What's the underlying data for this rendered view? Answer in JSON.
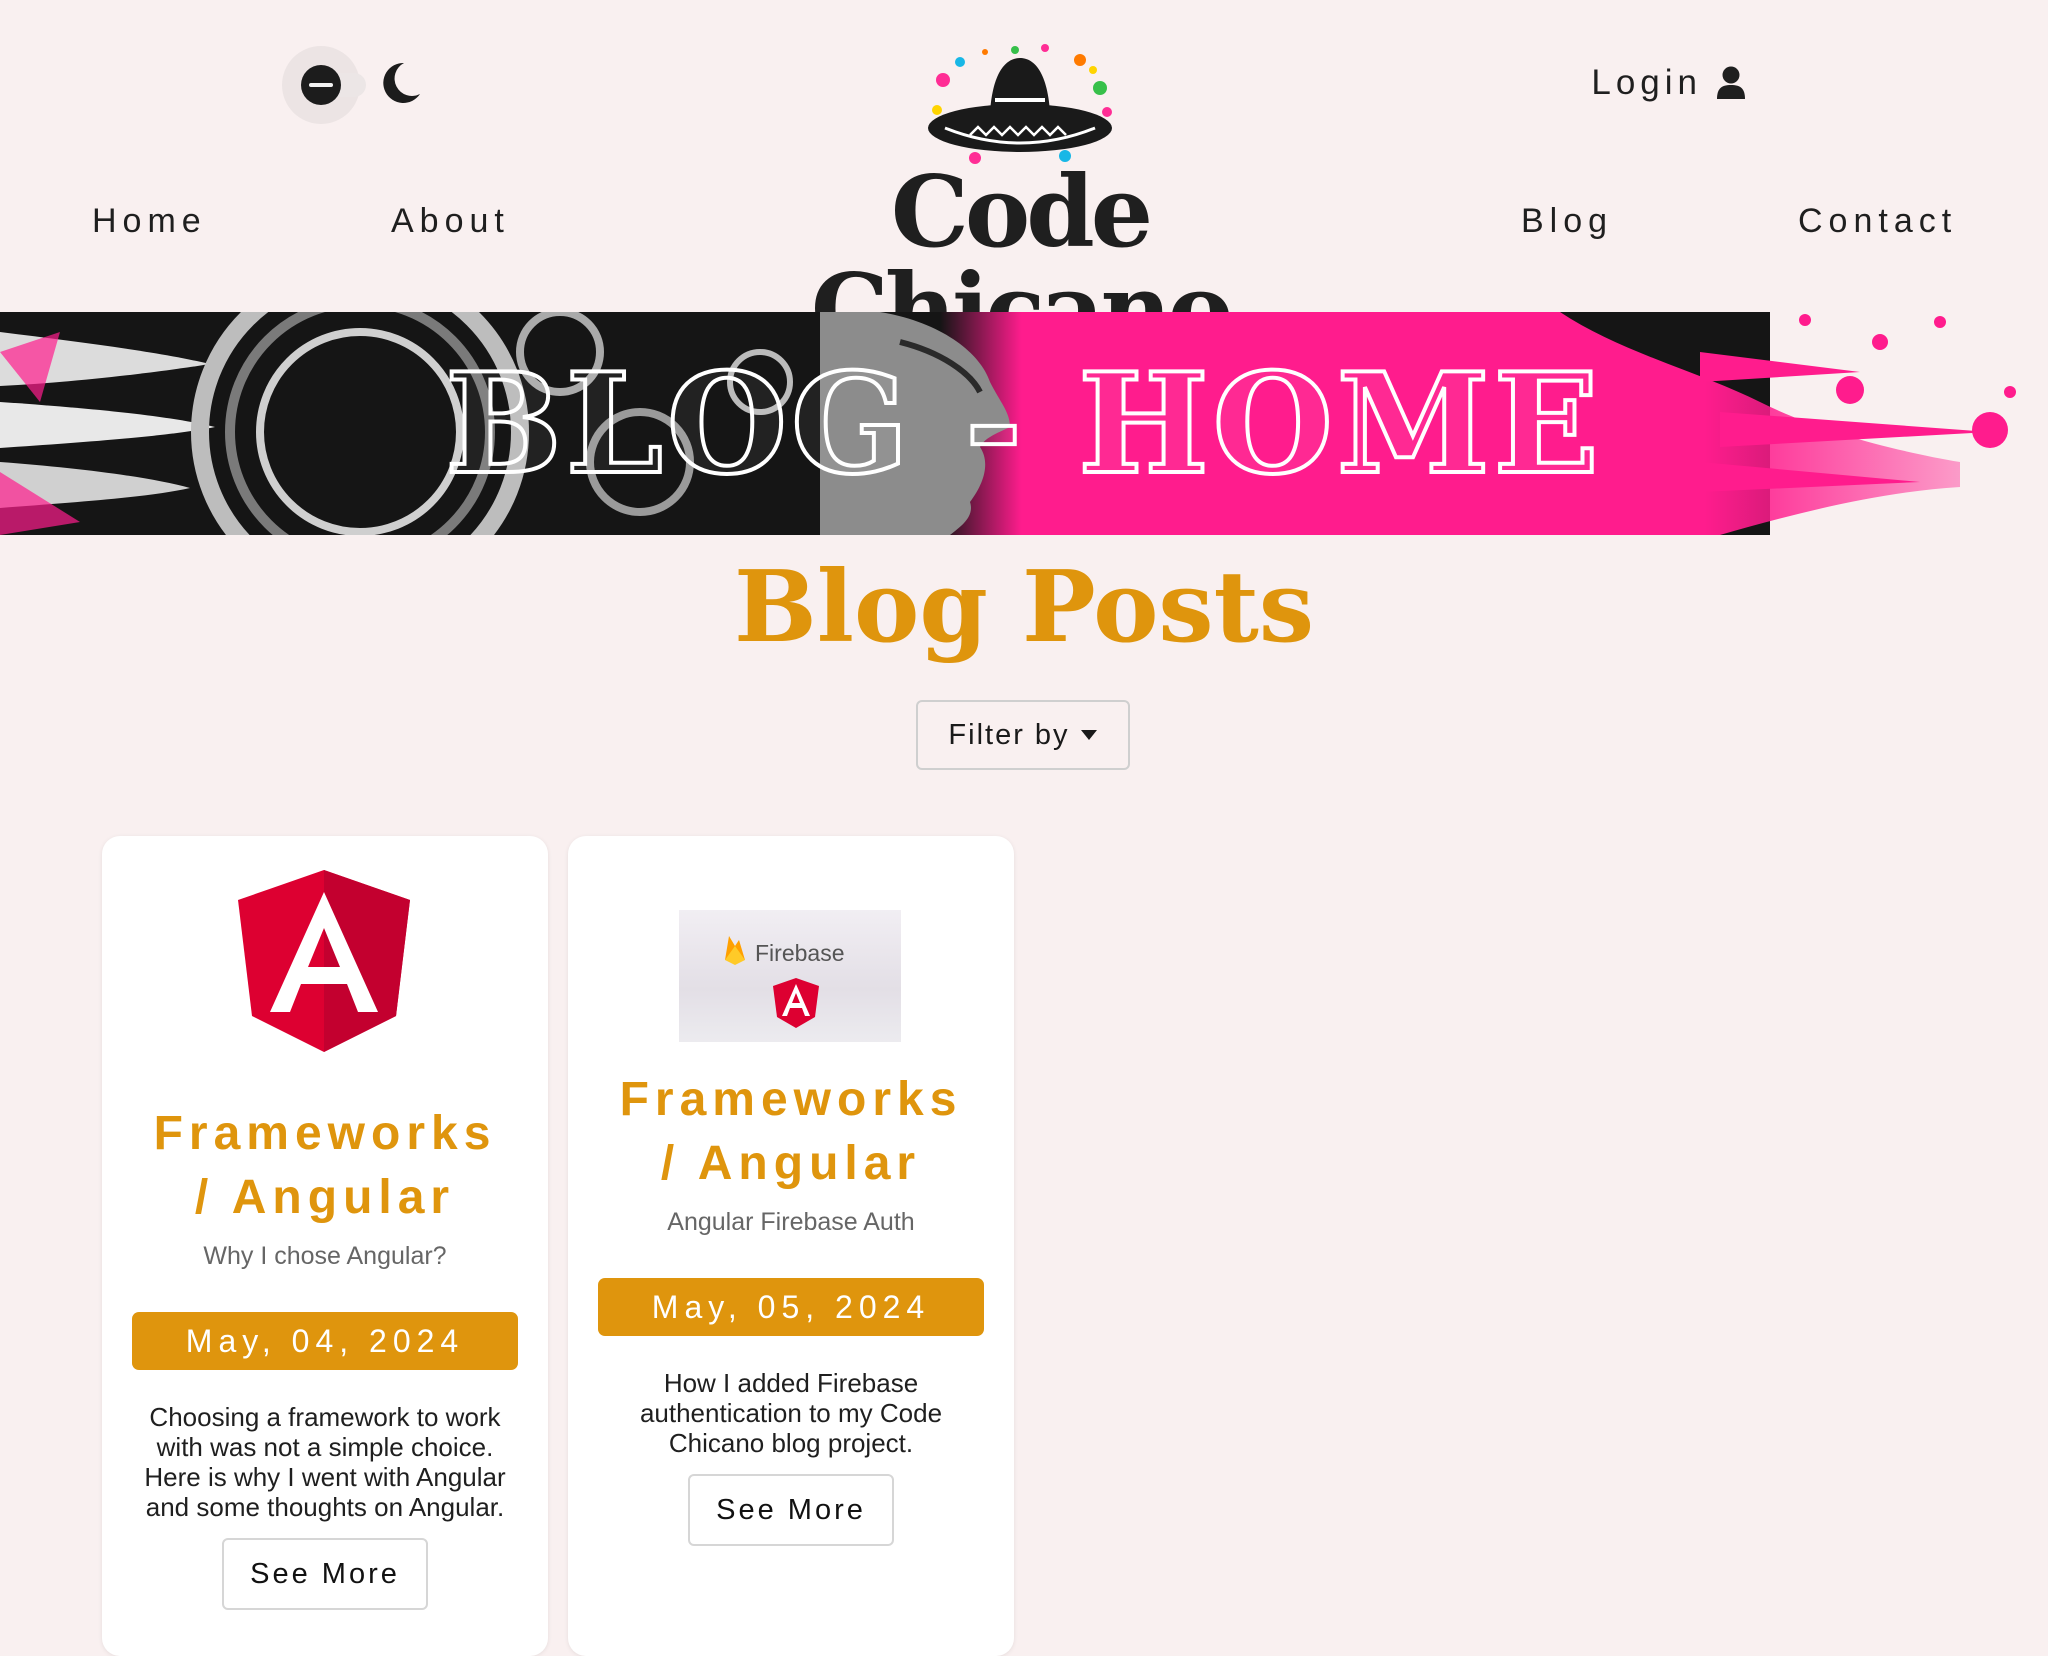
{
  "header": {
    "brand": "Code Chicano",
    "login_label": "Login",
    "nav": {
      "home": "Home",
      "about": "About",
      "blog": "Blog",
      "contact": "Contact"
    },
    "theme_toggle": {
      "state": "light",
      "icons": [
        "dark-mode-toggle",
        "moon-icon"
      ]
    }
  },
  "banner": {
    "title": "BLOG - HOME"
  },
  "main": {
    "title": "Blog Posts",
    "filter_label": "Filter by"
  },
  "posts": [
    {
      "image": "angular-logo",
      "category": [
        "Frameworks",
        "/ Angular"
      ],
      "subtitle": "Why I chose Angular?",
      "date": "May, 04, 2024",
      "description": "Choosing a framework to work with was not a simple choice. Here is why I went with Angular and some thoughts on Angular.",
      "button": "See More"
    },
    {
      "image": "firebase-angular-thumbnail",
      "image_text": "Firebase",
      "category": [
        "Frameworks",
        "/ Angular"
      ],
      "subtitle": "Angular Firebase Auth",
      "date": "May, 05, 2024",
      "description": "How I added Firebase authentication to my Code Chicano blog project.",
      "button": "See More"
    }
  ],
  "colors": {
    "background": "#f9f0f0",
    "accent": "#df950d",
    "banner_pink": "#ff1c8d",
    "angular_red": "#dd0031"
  }
}
